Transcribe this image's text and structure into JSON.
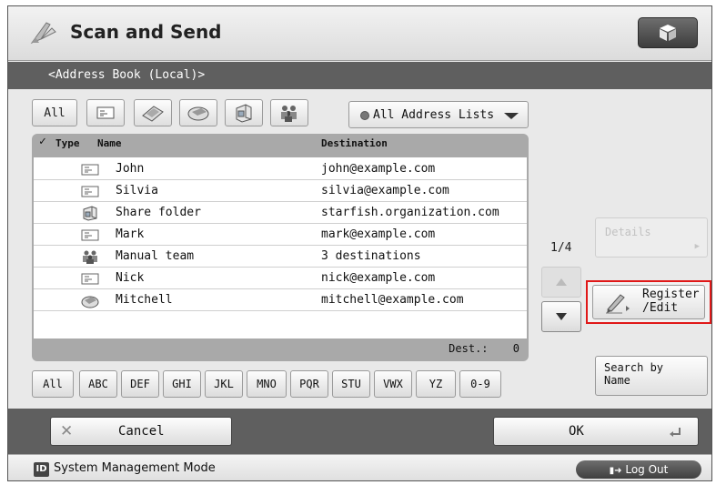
{
  "header": {
    "title": "Scan and Send"
  },
  "subheader": {
    "label": "<Address Book (Local)>"
  },
  "filters": {
    "all_label": "All",
    "address_list_label": "All Address Lists"
  },
  "list": {
    "col_type": "Type",
    "col_name": "Name",
    "col_destination": "Destination",
    "rows": [
      {
        "icon": "email-icon",
        "name": "John",
        "destination": "john@example.com"
      },
      {
        "icon": "email-icon",
        "name": "Silvia",
        "destination": "silvia@example.com"
      },
      {
        "icon": "folder-icon",
        "name": "Share folder",
        "destination": "starfish.organization.com"
      },
      {
        "icon": "email-icon",
        "name": "Mark",
        "destination": "mark@example.com"
      },
      {
        "icon": "group-icon",
        "name": "Manual team",
        "destination": "3 destinations"
      },
      {
        "icon": "email-icon",
        "name": "Nick",
        "destination": "nick@example.com"
      },
      {
        "icon": "ifax-icon",
        "name": "Mitchell",
        "destination": "mitchell@example.com"
      }
    ],
    "dest_label": "Dest.:",
    "dest_count": "0"
  },
  "alpha_tabs": [
    "All",
    "ABC",
    "DEF",
    "GHI",
    "JKL",
    "MNO",
    "PQR",
    "STU",
    "VWX",
    "YZ",
    "0-9"
  ],
  "side": {
    "details_label": "Details",
    "page_indicator": "1/4",
    "register_label_1": "Register",
    "register_label_2": "/Edit",
    "search_label_1": "Search by",
    "search_label_2": "Name"
  },
  "footer": {
    "cancel_label": "Cancel",
    "ok_label": "OK"
  },
  "status": {
    "mode_text": "System Management Mode",
    "id_badge": "ID",
    "logout_label": "Log Out"
  },
  "colors": {
    "highlight": "#e01818",
    "bar": "#5f5f5f"
  }
}
